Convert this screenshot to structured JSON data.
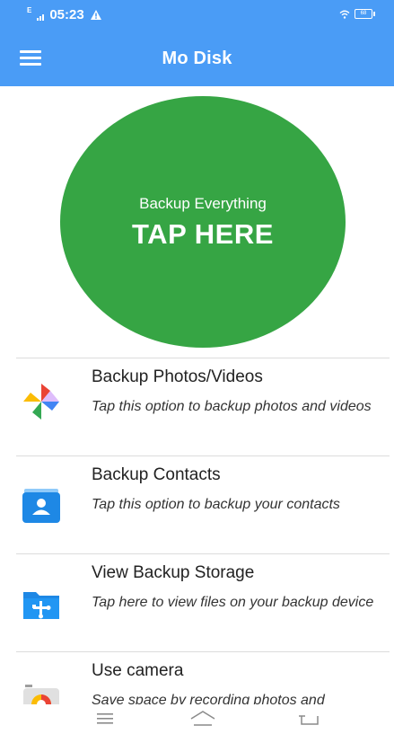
{
  "status_bar": {
    "time": "05:23",
    "network_label": "E",
    "battery_level": "68"
  },
  "app_bar": {
    "title": "Mo Disk"
  },
  "backup_button": {
    "subtitle": "Backup Everything",
    "label": "TAP HERE",
    "color": "#36a544"
  },
  "options": [
    {
      "title": "Backup Photos/Videos",
      "description": "Tap this option to backup photos and videos",
      "icon": "pinwheel-photos-icon"
    },
    {
      "title": "Backup Contacts",
      "description": "Tap this option to backup your contacts",
      "icon": "contacts-icon"
    },
    {
      "title": "View Backup Storage",
      "description": "Tap here to view files on your backup device",
      "icon": "usb-folder-icon"
    },
    {
      "title": "Use camera",
      "description": "Save space by recording photos and",
      "icon": "camera-icon"
    }
  ],
  "colors": {
    "primary": "#4a9cf6",
    "accent_green": "#36a544"
  }
}
